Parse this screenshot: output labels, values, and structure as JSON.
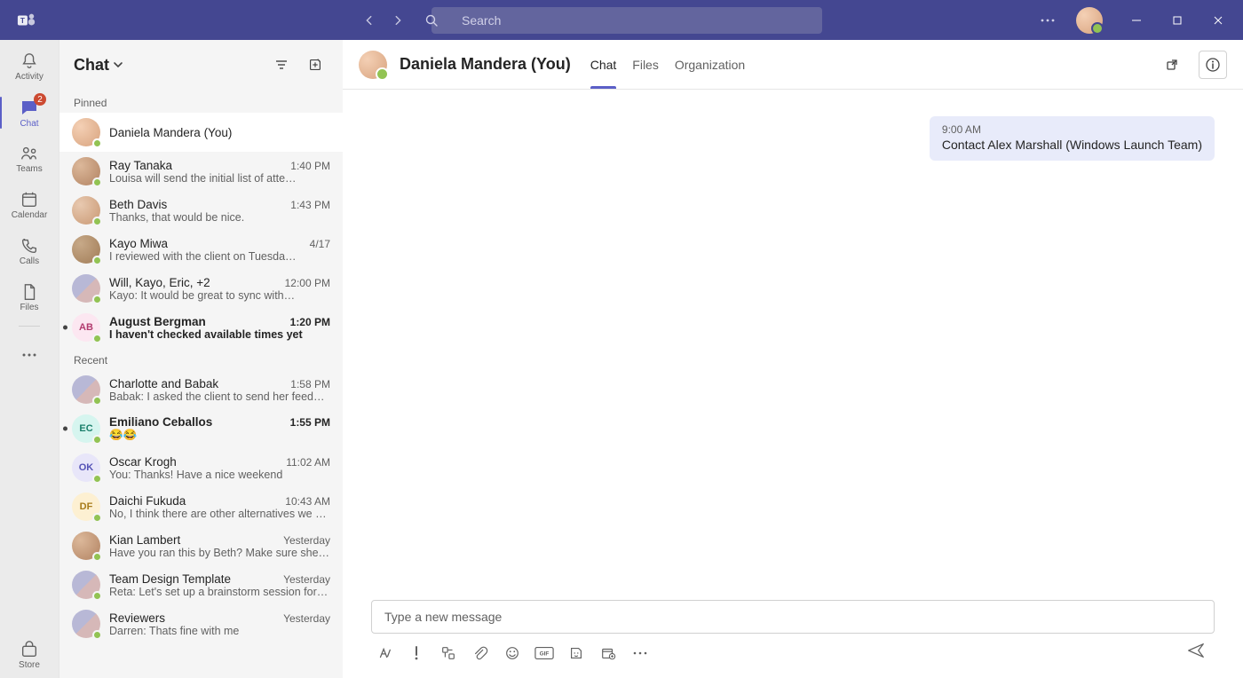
{
  "titlebar": {
    "search_placeholder": "Search"
  },
  "rail": {
    "items": [
      {
        "icon": "bell",
        "label": "Activity",
        "active": false
      },
      {
        "icon": "chat",
        "label": "Chat",
        "active": true,
        "badge": "2"
      },
      {
        "icon": "teams",
        "label": "Teams",
        "active": false
      },
      {
        "icon": "calendar",
        "label": "Calendar",
        "active": false
      },
      {
        "icon": "calls",
        "label": "Calls",
        "active": false
      },
      {
        "icon": "files",
        "label": "Files",
        "active": false
      }
    ],
    "store_label": "Store"
  },
  "chatPanel": {
    "title": "Chat",
    "sections": {
      "pinned_label": "Pinned",
      "recent_label": "Recent"
    },
    "pinned": [
      {
        "name": "Daniela Mandera (You)",
        "time": "",
        "preview": "",
        "avatar": "grad1",
        "selected": true
      },
      {
        "name": "Ray Tanaka",
        "time": "1:40 PM",
        "preview": "Louisa will send the initial list of atte…",
        "avatar": "grad2"
      },
      {
        "name": "Beth Davis",
        "time": "1:43 PM",
        "preview": "Thanks, that would be nice.",
        "avatar": "grad3"
      },
      {
        "name": "Kayo Miwa",
        "time": "4/17",
        "preview": "I reviewed with the client on Tuesda…",
        "avatar": "grad4"
      },
      {
        "name": "Will, Kayo, Eric, +2",
        "time": "12:00 PM",
        "preview": "Kayo: It would be great to sync with…",
        "avatar": "group"
      },
      {
        "name": "August Bergman",
        "time": "1:20 PM",
        "preview": "I haven't checked available times yet",
        "avatar": "light-pink",
        "initials": "AB",
        "unread": true
      }
    ],
    "recent": [
      {
        "name": "Charlotte and Babak",
        "time": "1:58 PM",
        "preview": "Babak: I asked the client to send her feed…",
        "avatar": "group"
      },
      {
        "name": "Emiliano Ceballos",
        "time": "1:55 PM",
        "preview": "😂😂",
        "avatar": "light-teal",
        "initials": "EC",
        "unread": true
      },
      {
        "name": "Oscar Krogh",
        "time": "11:02 AM",
        "preview": "You: Thanks! Have a nice weekend",
        "avatar": "light-purple",
        "initials": "OK"
      },
      {
        "name": "Daichi Fukuda",
        "time": "10:43 AM",
        "preview": "No, I think there are other alternatives we c…",
        "avatar": "light-yellow",
        "initials": "DF"
      },
      {
        "name": "Kian Lambert",
        "time": "Yesterday",
        "preview": "Have you ran this by Beth? Make sure she is…",
        "avatar": "grad2"
      },
      {
        "name": "Team Design Template",
        "time": "Yesterday",
        "preview": "Reta: Let's set up a brainstorm session for…",
        "avatar": "group"
      },
      {
        "name": "Reviewers",
        "time": "Yesterday",
        "preview": "Darren: Thats fine with me",
        "avatar": "group"
      }
    ]
  },
  "conversation": {
    "title": "Daniela Mandera (You)",
    "tabs": [
      {
        "label": "Chat",
        "active": true
      },
      {
        "label": "Files",
        "active": false
      },
      {
        "label": "Organization",
        "active": false
      }
    ],
    "messages": [
      {
        "time": "9:00 AM",
        "text": "Contact Alex Marshall (Windows Launch Team)",
        "out": true
      }
    ],
    "composer_placeholder": "Type a new message"
  }
}
